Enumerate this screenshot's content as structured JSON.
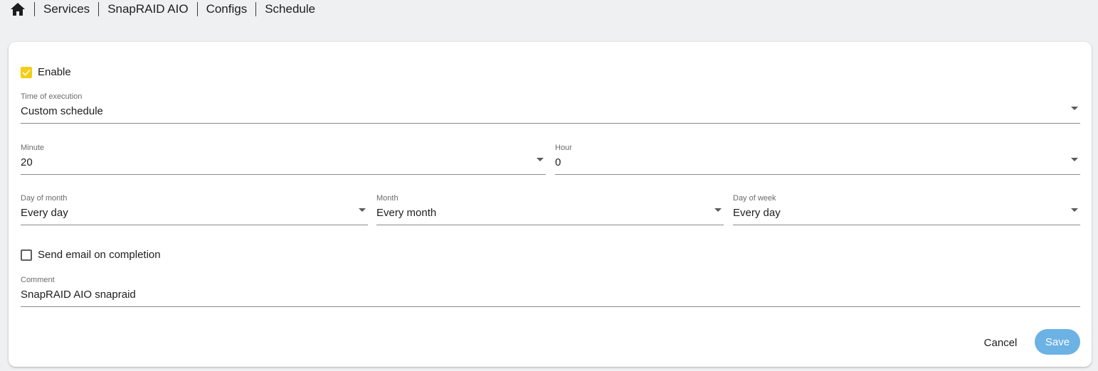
{
  "breadcrumb": {
    "home_icon": "home-icon",
    "items": [
      "Services",
      "SnapRAID AIO",
      "Configs",
      "Schedule"
    ]
  },
  "form": {
    "enable": {
      "label": "Enable",
      "checked": true
    },
    "time_of_execution": {
      "label": "Time of execution",
      "value": "Custom schedule"
    },
    "minute": {
      "label": "Minute",
      "value": "20"
    },
    "hour": {
      "label": "Hour",
      "value": "0"
    },
    "day_of_month": {
      "label": "Day of month",
      "value": "Every day"
    },
    "month": {
      "label": "Month",
      "value": "Every month"
    },
    "day_of_week": {
      "label": "Day of week",
      "value": "Every day"
    },
    "send_email": {
      "label": "Send email on completion",
      "checked": false
    },
    "comment": {
      "label": "Comment",
      "value": "SnapRAID AIO snapraid"
    }
  },
  "actions": {
    "cancel_label": "Cancel",
    "save_label": "Save"
  },
  "colors": {
    "accent_checkbox": "#f4ce14",
    "save_button": "#6cb2e4",
    "background": "#eff0f2"
  }
}
